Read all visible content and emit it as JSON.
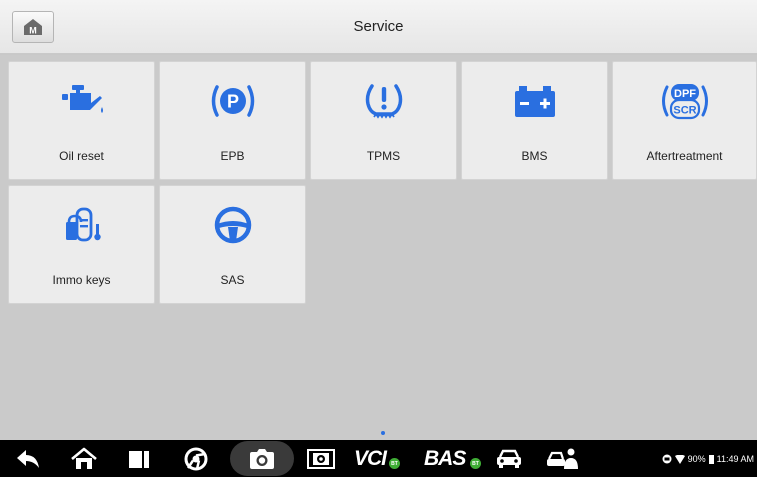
{
  "header": {
    "title": "Service",
    "home_icon_letter": "M"
  },
  "tiles": [
    {
      "label": "Oil reset",
      "icon": "oil-can-icon"
    },
    {
      "label": "EPB",
      "icon": "parking-brake-icon"
    },
    {
      "label": "TPMS",
      "icon": "tire-pressure-icon"
    },
    {
      "label": "BMS",
      "icon": "battery-icon"
    },
    {
      "label": "Aftertreatment",
      "icon": "dpf-scr-icon",
      "icon_text_top": "DPF",
      "icon_text_bottom": "SCR"
    },
    {
      "label": "Immo keys",
      "icon": "immo-key-icon"
    },
    {
      "label": "SAS",
      "icon": "steering-wheel-icon"
    }
  ],
  "navbar": {
    "vci_label": "VCI",
    "vci_badge": "BT",
    "bas_label": "BAS",
    "bas_badge": "BT"
  },
  "status": {
    "battery_percent": "90%",
    "time": "11:49 AM"
  },
  "colors": {
    "accent": "#2a6fe0",
    "tile_background": "#ececec",
    "page_background": "#cacaca",
    "badge_green": "#3fae35"
  }
}
